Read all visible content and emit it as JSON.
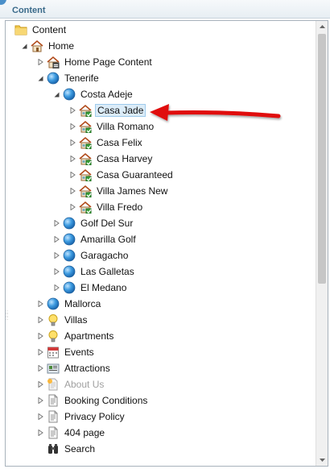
{
  "header": {
    "title": "Content"
  },
  "tree": [
    {
      "label": "Content",
      "icon": "folder-icon",
      "toggle": "none",
      "level": 0
    },
    {
      "label": "Home",
      "icon": "home-icon",
      "toggle": "expanded",
      "level": 1
    },
    {
      "label": "Home Page Content",
      "icon": "home-content-icon",
      "toggle": "collapsed",
      "level": 2
    },
    {
      "label": "Tenerife",
      "icon": "globe-icon",
      "toggle": "expanded",
      "level": 2
    },
    {
      "label": "Costa Adeje",
      "icon": "globe-icon",
      "toggle": "expanded",
      "level": 3
    },
    {
      "label": "Casa Jade",
      "icon": "house-green-icon",
      "toggle": "collapsed",
      "level": 4,
      "selected": true
    },
    {
      "label": "Villa Romano",
      "icon": "house-green-icon",
      "toggle": "collapsed",
      "level": 4
    },
    {
      "label": "Casa Felix",
      "icon": "house-green-icon",
      "toggle": "collapsed",
      "level": 4
    },
    {
      "label": "Casa Harvey",
      "icon": "house-green-icon",
      "toggle": "collapsed",
      "level": 4
    },
    {
      "label": "Casa Guaranteed",
      "icon": "house-green-icon",
      "toggle": "collapsed",
      "level": 4
    },
    {
      "label": "Villa James New",
      "icon": "house-green-icon",
      "toggle": "collapsed",
      "level": 4
    },
    {
      "label": "Villa Fredo",
      "icon": "house-green-icon",
      "toggle": "collapsed",
      "level": 4
    },
    {
      "label": "Golf Del Sur",
      "icon": "globe-icon",
      "toggle": "collapsed",
      "level": 3
    },
    {
      "label": "Amarilla Golf",
      "icon": "globe-icon",
      "toggle": "collapsed",
      "level": 3
    },
    {
      "label": "Garagacho",
      "icon": "globe-icon",
      "toggle": "collapsed",
      "level": 3
    },
    {
      "label": "Las Galletas",
      "icon": "globe-icon",
      "toggle": "collapsed",
      "level": 3
    },
    {
      "label": "El Medano",
      "icon": "globe-icon",
      "toggle": "collapsed",
      "level": 3
    },
    {
      "label": "Mallorca",
      "icon": "globe-icon",
      "toggle": "collapsed",
      "level": 2
    },
    {
      "label": "Villas",
      "icon": "lightbulb-icon",
      "toggle": "collapsed",
      "level": 2
    },
    {
      "label": "Apartments",
      "icon": "lightbulb-icon",
      "toggle": "collapsed",
      "level": 2
    },
    {
      "label": "Events",
      "icon": "calendar-icon",
      "toggle": "collapsed",
      "level": 2
    },
    {
      "label": "Attractions",
      "icon": "attractions-icon",
      "toggle": "collapsed",
      "level": 2
    },
    {
      "label": "About Us",
      "icon": "document-new-icon",
      "toggle": "collapsed",
      "level": 2,
      "disabled": true
    },
    {
      "label": "Booking Conditions",
      "icon": "document-icon",
      "toggle": "collapsed",
      "level": 2
    },
    {
      "label": "Privacy Policy",
      "icon": "document-icon",
      "toggle": "collapsed",
      "level": 2
    },
    {
      "label": "404 page",
      "icon": "document-icon",
      "toggle": "collapsed",
      "level": 2
    },
    {
      "label": "Search",
      "icon": "binoculars-icon",
      "toggle": "none",
      "level": 2
    }
  ],
  "colors": {
    "selection": "#dbecf8",
    "arrow": "#e01010",
    "header_text": "#3a6a8a"
  }
}
